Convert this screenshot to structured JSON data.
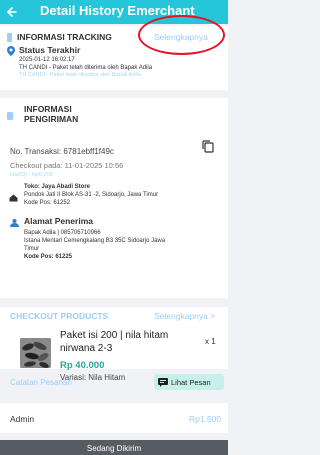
{
  "header": {
    "title": "Detail History Emerchant"
  },
  "tracking": {
    "section_title": "INFORMASI TRACKING",
    "link_label": "Selengkapnya",
    "status_label": "Status Terakhir",
    "timestamp": "2025-01-12 16:02:17",
    "message": "TH CANDI - Paket telah diterima oleh Bapak Adila",
    "message_faded": "TH CANDI - Paket telah diterima oleh Bapak Adila"
  },
  "shipping": {
    "section_title_line1": "INFORMASI",
    "section_title_line2": "PENGIRIMAN",
    "transaction_label": "No. Transaksi: 6781ebff1f49c",
    "checkout_label": "Checkout pada: 11-01-2025 10:56",
    "faded_id": "Idx(03) - Rp5.200",
    "store_name": "Toko: Jaya Abadi Store",
    "store_address": "Pondok Jati II Blok AS-31 -2, Sidoarjo, Jawa Timur",
    "store_postcode": "Kode Pos: 61252",
    "recipient_label": "Alamat Penerima",
    "recipient_name": "Bapak Adila | 085706710966",
    "recipient_address_line1": "Istana Mentari Cemengkalang B3 35C Sidoarjo Jawa",
    "recipient_address_line2": "Timur",
    "recipient_postcode": "Kode Pos: 61225"
  },
  "products": {
    "section_title": "CHECKOUT PRODUCTS",
    "link_label": "Selengkapnya",
    "link_arrow": ">",
    "item": {
      "name_line1": "Paket isi 200 | nila hitam",
      "name_line2": "nirwana 2-3",
      "price": "Rp 40.000",
      "variant": "Variasi: Nila Hitam",
      "quantity": "x 1"
    }
  },
  "notes": {
    "label": "Catatan Pesanan",
    "button_label": "Lihat Pesan"
  },
  "admin": {
    "label": "Admin",
    "value": "Rp1.500"
  },
  "bottom": {
    "status": "Sedang Dikirim"
  },
  "colors": {
    "header": "#26c6da",
    "accent_link": "#9ecdf6",
    "price_green": "#26a69a",
    "annotation_red": "#e8102a"
  }
}
